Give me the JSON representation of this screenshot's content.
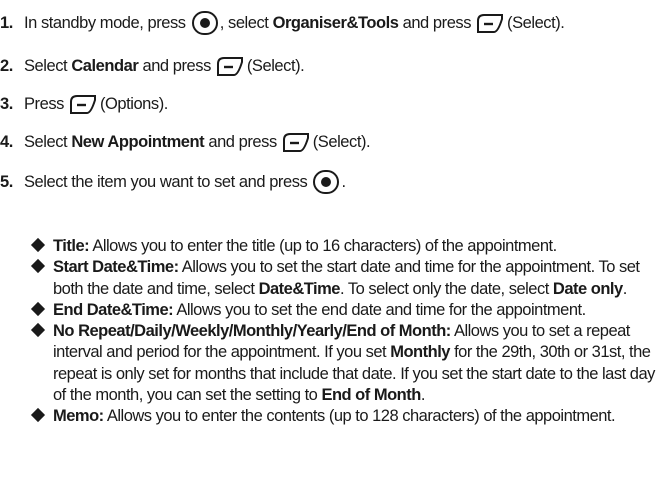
{
  "steps": [
    {
      "num": "1.",
      "pre": "In standby mode, press",
      "mid1": ", select",
      "bold1": "Organiser&Tools",
      "mid2": "and press",
      "post": "(Select)."
    },
    {
      "num": "2.",
      "pre": "Select",
      "bold1": "Calendar",
      "mid1": "and press",
      "post": "(Select)."
    },
    {
      "num": "3.",
      "pre": "Press",
      "post": "(Options)."
    },
    {
      "num": "4.",
      "pre": "Select",
      "bold1": "New Appointment",
      "mid1": "and press",
      "post": "(Select)."
    },
    {
      "num": "5.",
      "pre": "Select the item you want to set and press",
      "post": "."
    }
  ],
  "bullets": {
    "title": {
      "term": "Title:",
      "text": "Allows you to enter the title (up to 16 characters) of the appointment."
    },
    "start": {
      "term": "Start Date&Time:",
      "text1": "Allows you to set the start date and time for the appointment. To set both the date and time, select",
      "b1": "Date&Time",
      "text2": ". To select only the date, select",
      "b2": "Date only",
      "text3": "."
    },
    "end": {
      "term": "End Date&Time:",
      "text": "Allows you to set the end date and time for the appointment."
    },
    "repeat": {
      "term": "No Repeat/Daily/Weekly/Monthly/Yearly/End of Month:",
      "text1": "Allows you to set a repeat interval and period for the appointment. If you set",
      "b1": "Monthly",
      "text2": "for the 29th, 30th or 31st, the repeat is only set for months that include that date. If you set the start date to the last day of the month, you can set the setting to",
      "b2": "End of Month",
      "text3": "."
    },
    "memo": {
      "term": "Memo:",
      "text": "Allows you to enter the contents (up to 128 characters) of the appointment."
    }
  },
  "icons": {
    "center_key": "center-key-icon",
    "soft_key": "left-soft-key-icon"
  }
}
